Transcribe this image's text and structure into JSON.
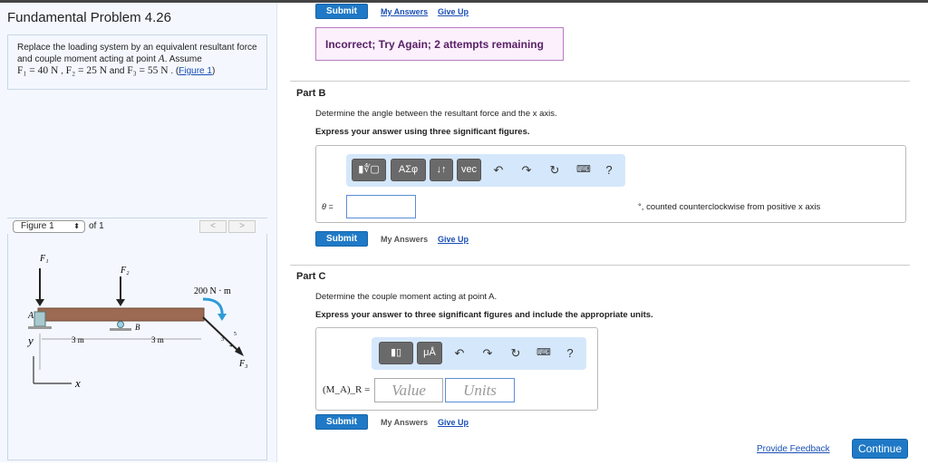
{
  "problem": {
    "title": "Fundamental Problem 4.26",
    "text1": "Replace the loading system by an equivalent resultant force and couple moment acting at point ",
    "point": "A",
    "text2": ". Assume",
    "f1": "F₁ = 40 N",
    "f2": "F₂ = 25 N",
    "and": " and ",
    "f3": "F₃ = 55 N",
    "figure_link": "Figure 1"
  },
  "figure": {
    "selector": "Figure 1",
    "of": "of 1",
    "prev": "<",
    "next": ">",
    "labels": {
      "f1": "F₁",
      "f2": "F₂",
      "f3": "F₃",
      "moment": "200 N · m",
      "a": "A",
      "b": "B",
      "d1": "3 m",
      "d2": "3 m",
      "y": "y",
      "x": "x",
      "s3": "3",
      "s4": "4",
      "s5": "5"
    }
  },
  "top": {
    "submit": "Submit",
    "my_answers": "My Answers",
    "give_up": "Give Up",
    "feedback": "Incorrect; Try Again; 2 attempts remaining"
  },
  "partB": {
    "label": "Part B",
    "question": "Determine the angle between the resultant force and the x axis.",
    "instruction": "Express your answer using three significant figures.",
    "toolbar": [
      "▮∜▢",
      "ΑΣφ",
      "↓↑",
      "vec"
    ],
    "var": "θ =",
    "value": "",
    "unit": "°, counted counterclockwise from positive x axis",
    "submit": "Submit",
    "my_answers": "My Answers",
    "give_up": "Give Up"
  },
  "partC": {
    "label": "Part C",
    "question": "Determine the couple moment acting at point A.",
    "instruction": "Express your answer to three significant figures and include the appropriate units.",
    "toolbar": [
      "▮▯",
      "μÅ"
    ],
    "var": "(M_A)_R =",
    "value_placeholder": "Value",
    "units_placeholder": "Units",
    "submit": "Submit",
    "my_answers": "My Answers",
    "give_up": "Give Up"
  },
  "footer": {
    "feedback": "Provide Feedback",
    "continue": "Continue"
  },
  "colors": {
    "accent": "#1f79c6",
    "incorrect_bg": "#fbf0fc",
    "toolbar_bg": "#d5e7fb"
  }
}
